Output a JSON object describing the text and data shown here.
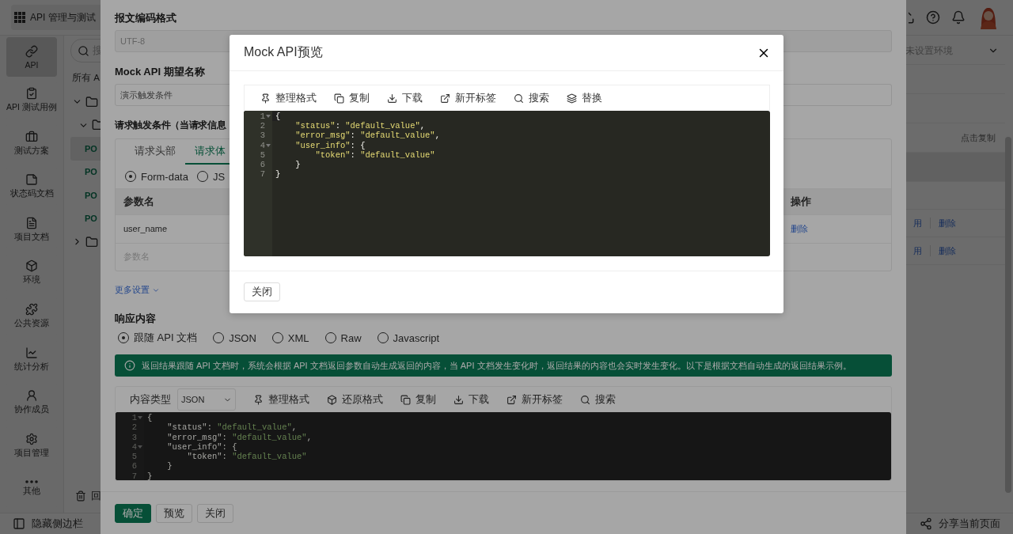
{
  "app": {
    "title": "API 管理与测试",
    "nav": [
      {
        "label": "API",
        "kind": "link",
        "selected": true
      },
      {
        "label": "API 测试用例",
        "kind": "clipboard",
        "selected": false
      },
      {
        "label": "测试方案",
        "kind": "briefcase",
        "selected": false
      },
      {
        "label": "状态码文档",
        "kind": "note",
        "selected": false
      },
      {
        "label": "项目文档",
        "kind": "doc",
        "selected": false
      },
      {
        "label": "环境",
        "kind": "cube",
        "selected": false
      },
      {
        "label": "公共资源",
        "kind": "puzzle",
        "selected": false
      },
      {
        "label": "统计分析",
        "kind": "chart",
        "selected": false
      },
      {
        "label": "协作成员",
        "kind": "user",
        "selected": false
      },
      {
        "label": "项目管理",
        "kind": "settings",
        "selected": false
      },
      {
        "label": "其他",
        "kind": "more",
        "selected": false
      }
    ],
    "explorer": {
      "placeholder": "搜",
      "all_label": "所有 A",
      "tree": [
        {
          "expanded": true,
          "children": [
            {
              "expanded": true,
              "children": [
                {
                  "method": "PO",
                  "selected": true
                },
                {
                  "method": "PO",
                  "selected": false
                },
                {
                  "method": "PO",
                  "selected": false
                },
                {
                  "method": "PO",
                  "selected": false
                }
              ]
            }
          ]
        },
        {
          "expanded": false
        }
      ],
      "trash_label": "回"
    },
    "hide_sidebar": "隐藏侧边栏",
    "environment": "未设置环境",
    "copy_hint": "点击复制",
    "rows": [
      {
        "enable": "用",
        "delete": "删除"
      },
      {
        "enable": "用",
        "delete": "删除"
      }
    ],
    "share": "分享当前页面"
  },
  "drawer": {
    "encoding_label": "报文编码格式",
    "encoding_value": "UTF-8",
    "mock_name_label": "Mock API 期望名称",
    "mock_name_value": "演示触发条件",
    "trigger_label": "请求触发条件（当请求信息",
    "tabs": [
      {
        "label": "请求头部",
        "selected": false
      },
      {
        "label": "请求体",
        "selected": true
      }
    ],
    "body_types": [
      {
        "label": "Form-data",
        "selected": true
      },
      {
        "label": "JS",
        "selected": false
      }
    ],
    "table": {
      "columns": [
        "参数名",
        "操作"
      ],
      "rows": [
        {
          "name": "user_name",
          "action": "删除"
        },
        {
          "placeholder": "参数名"
        }
      ]
    },
    "more_settings": "更多设置",
    "response_label": "响应内容",
    "response_types": [
      {
        "label": "跟随 API 文档",
        "selected": true
      },
      {
        "label": "JSON",
        "selected": false
      },
      {
        "label": "XML",
        "selected": false
      },
      {
        "label": "Raw",
        "selected": false
      },
      {
        "label": "Javascript",
        "selected": false
      }
    ],
    "alert": "返回结果跟随 API 文档时，系统会根据 API 文档返回参数自动生成返回的内容，当 API 文档发生变化时，返回结果的内容也会实时发生变化。以下是根据文档自动生成的返回结果示例。",
    "editor": {
      "content_type_label": "内容类型",
      "content_type": "JSON",
      "tools": [
        {
          "label": "整理格式",
          "kind": "format"
        },
        {
          "label": "还原格式",
          "kind": "restore"
        },
        {
          "label": "复制",
          "kind": "copy"
        },
        {
          "label": "下载",
          "kind": "download"
        },
        {
          "label": "新开标签",
          "kind": "open"
        },
        {
          "label": "搜索",
          "kind": "search"
        }
      ],
      "lines": [
        {
          "number": "1",
          "text": "{",
          "foldable": true
        },
        {
          "number": "2",
          "text": "    \"status\": \"default_value\",",
          "foldable": false
        },
        {
          "number": "3",
          "text": "    \"error_msg\": \"default_value\",",
          "foldable": false
        },
        {
          "number": "4",
          "text": "    \"user_info\": {",
          "foldable": true
        },
        {
          "number": "5",
          "text": "        \"token\": \"default_value\"",
          "foldable": false
        },
        {
          "number": "6",
          "text": "    }",
          "foldable": false
        },
        {
          "number": "7",
          "text": "}",
          "foldable": false
        }
      ]
    },
    "buttons": [
      {
        "label": "确定",
        "kind": "primary"
      },
      {
        "label": "预览",
        "kind": "default"
      },
      {
        "label": "关闭",
        "kind": "default"
      }
    ]
  },
  "modal": {
    "title": "Mock API预览",
    "tools": [
      {
        "label": "整理格式",
        "kind": "format"
      },
      {
        "label": "复制",
        "kind": "copy"
      },
      {
        "label": "下载",
        "kind": "download"
      },
      {
        "label": "新开标签",
        "kind": "open"
      },
      {
        "label": "搜索",
        "kind": "search"
      },
      {
        "label": "替换",
        "kind": "replace"
      }
    ],
    "lines": [
      {
        "number": "1",
        "text": "{",
        "foldable": true
      },
      {
        "number": "2",
        "text": "    \"status\": \"default_value\",",
        "foldable": false
      },
      {
        "number": "3",
        "text": "    \"error_msg\": \"default_value\",",
        "foldable": false
      },
      {
        "number": "4",
        "text": "    \"user_info\": {",
        "foldable": true
      },
      {
        "number": "5",
        "text": "        \"token\": \"default_value\"",
        "foldable": false
      },
      {
        "number": "6",
        "text": "    }",
        "foldable": false
      },
      {
        "number": "7",
        "text": "}",
        "foldable": false
      }
    ],
    "close_button": "关闭"
  }
}
